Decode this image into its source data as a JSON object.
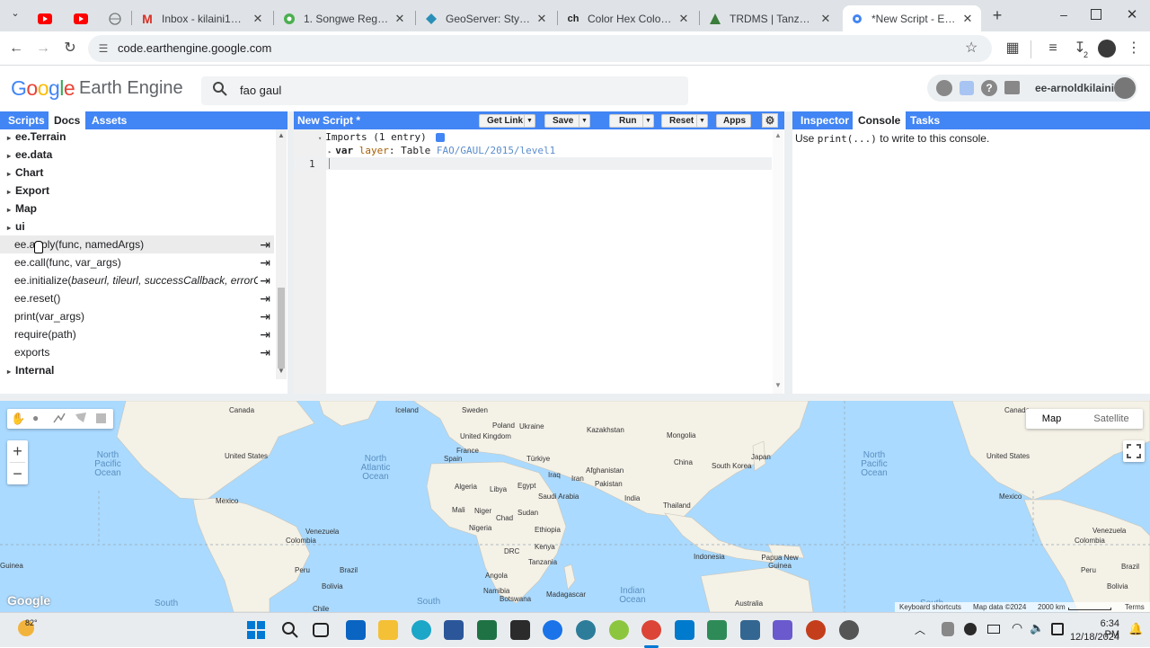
{
  "browser": {
    "tabs": [
      {
        "title": "",
        "icon": "youtube-icon"
      },
      {
        "title": "",
        "icon": "youtube-icon"
      },
      {
        "title": "",
        "icon": "globe-icon"
      },
      {
        "title": "Inbox - kilaini1@gmai",
        "icon": "gmail-icon"
      },
      {
        "title": "1. Songwe Region - G",
        "icon": "chrome-web-icon"
      },
      {
        "title": "GeoServer: Style Edito",
        "icon": "geoserver-icon"
      },
      {
        "title": "Color Hex Color Code",
        "icon": "colorhex-icon",
        "fav": "ch"
      },
      {
        "title": "TRDMS | Tanzania Roa",
        "icon": "trdms-icon"
      },
      {
        "title": "*New Script - Earth En",
        "icon": "earth-engine-icon",
        "active": true
      }
    ],
    "new_tab": "+",
    "url": "code.earthengine.google.com",
    "download_count": "2"
  },
  "ee": {
    "logo_google": "Google",
    "logo_product": "Earth Engine",
    "search_value": "fao gaul",
    "user": "ee-arnoldkilaini",
    "left_tabs": [
      "Scripts",
      "Docs",
      "Assets"
    ],
    "docs_groups": [
      "ee.Terrain",
      "ee.data",
      "Chart",
      "Export",
      "Map",
      "ui"
    ],
    "docs_functions": [
      "ee.apply(func, namedArgs)",
      "ee.call(func, var_args)",
      "ee.reset()",
      "print(var_args)",
      "require(path)",
      "exports"
    ],
    "ee_initialize": {
      "name": "ee.initialize(",
      "args": "baseurl, tileurl, successCallback, errorC",
      "suffix": "..."
    },
    "docs_internal": "Internal",
    "editor": {
      "title": "New Script *",
      "buttons": [
        "Get Link",
        "Save",
        "Run",
        "Reset",
        "Apps"
      ],
      "imports_label": "Imports (1 entry)",
      "import_keyword": "var",
      "import_name": "layer",
      "import_type": "Table",
      "import_id": "FAO/GAUL/2015/level1",
      "line_number": "1"
    },
    "right_tabs": [
      "Inspector",
      "Console",
      "Tasks"
    ],
    "console_text_pre": "Use ",
    "console_code": "print(...)",
    "console_text_post": " to write to this console."
  },
  "map": {
    "type_buttons": [
      "Map",
      "Satellite"
    ],
    "zoom_in": "+",
    "zoom_out": "−",
    "labels": [
      {
        "t": "Canada"
      },
      {
        "t": "United States"
      },
      {
        "t": "Mexico"
      },
      {
        "t": "Venezuela"
      },
      {
        "t": "Colombia"
      },
      {
        "t": "Peru"
      },
      {
        "t": "Brazil"
      },
      {
        "t": "Bolivia"
      },
      {
        "t": "Chile"
      },
      {
        "t": "Guinea"
      },
      {
        "t": "Iceland"
      },
      {
        "t": "Sweden"
      },
      {
        "t": "United Kingdom"
      },
      {
        "t": "Ukraine"
      },
      {
        "t": "Poland"
      },
      {
        "t": "France"
      },
      {
        "t": "Spain"
      },
      {
        "t": "Türkiye"
      },
      {
        "t": "Kazakhstan"
      },
      {
        "t": "Mongolia"
      },
      {
        "t": "Iraq"
      },
      {
        "t": "Iran"
      },
      {
        "t": "Afghanistan"
      },
      {
        "t": "Pakistan"
      },
      {
        "t": "China"
      },
      {
        "t": "South Korea"
      },
      {
        "t": "Japan"
      },
      {
        "t": "India"
      },
      {
        "t": "Thailand"
      },
      {
        "t": "Algeria"
      },
      {
        "t": "Libya"
      },
      {
        "t": "Egypt"
      },
      {
        "t": "Saudi Arabia"
      },
      {
        "t": "Mali"
      },
      {
        "t": "Niger"
      },
      {
        "t": "Chad"
      },
      {
        "t": "Sudan"
      },
      {
        "t": "Nigeria"
      },
      {
        "t": "Ethiopia"
      },
      {
        "t": "DRC"
      },
      {
        "t": "Kenya"
      },
      {
        "t": "Tanzania"
      },
      {
        "t": "Angola"
      },
      {
        "t": "Namibia"
      },
      {
        "t": "Botswana"
      },
      {
        "t": "Madagascar"
      },
      {
        "t": "Indonesia"
      },
      {
        "t": "Papua New Guinea"
      },
      {
        "t": "Australia"
      },
      {
        "t": "United States"
      },
      {
        "t": "Mexico"
      },
      {
        "t": "Venezuela"
      },
      {
        "t": "Colombia"
      },
      {
        "t": "Peru"
      },
      {
        "t": "Brazil"
      },
      {
        "t": "Bolivia"
      },
      {
        "t": "Canada"
      }
    ],
    "oceans": [
      "North Pacific Ocean",
      "North Atlantic Ocean",
      "North Pacific Ocean",
      "South",
      "South",
      "Indian Ocean",
      "South"
    ],
    "attribution": [
      "Keyboard shortcuts",
      "Map data ©2024",
      "2000 km",
      "Terms"
    ],
    "google_watermark": "Google"
  },
  "taskbar": {
    "weather": "82°",
    "time": "6:34 PM",
    "date": "12/18/2024"
  }
}
